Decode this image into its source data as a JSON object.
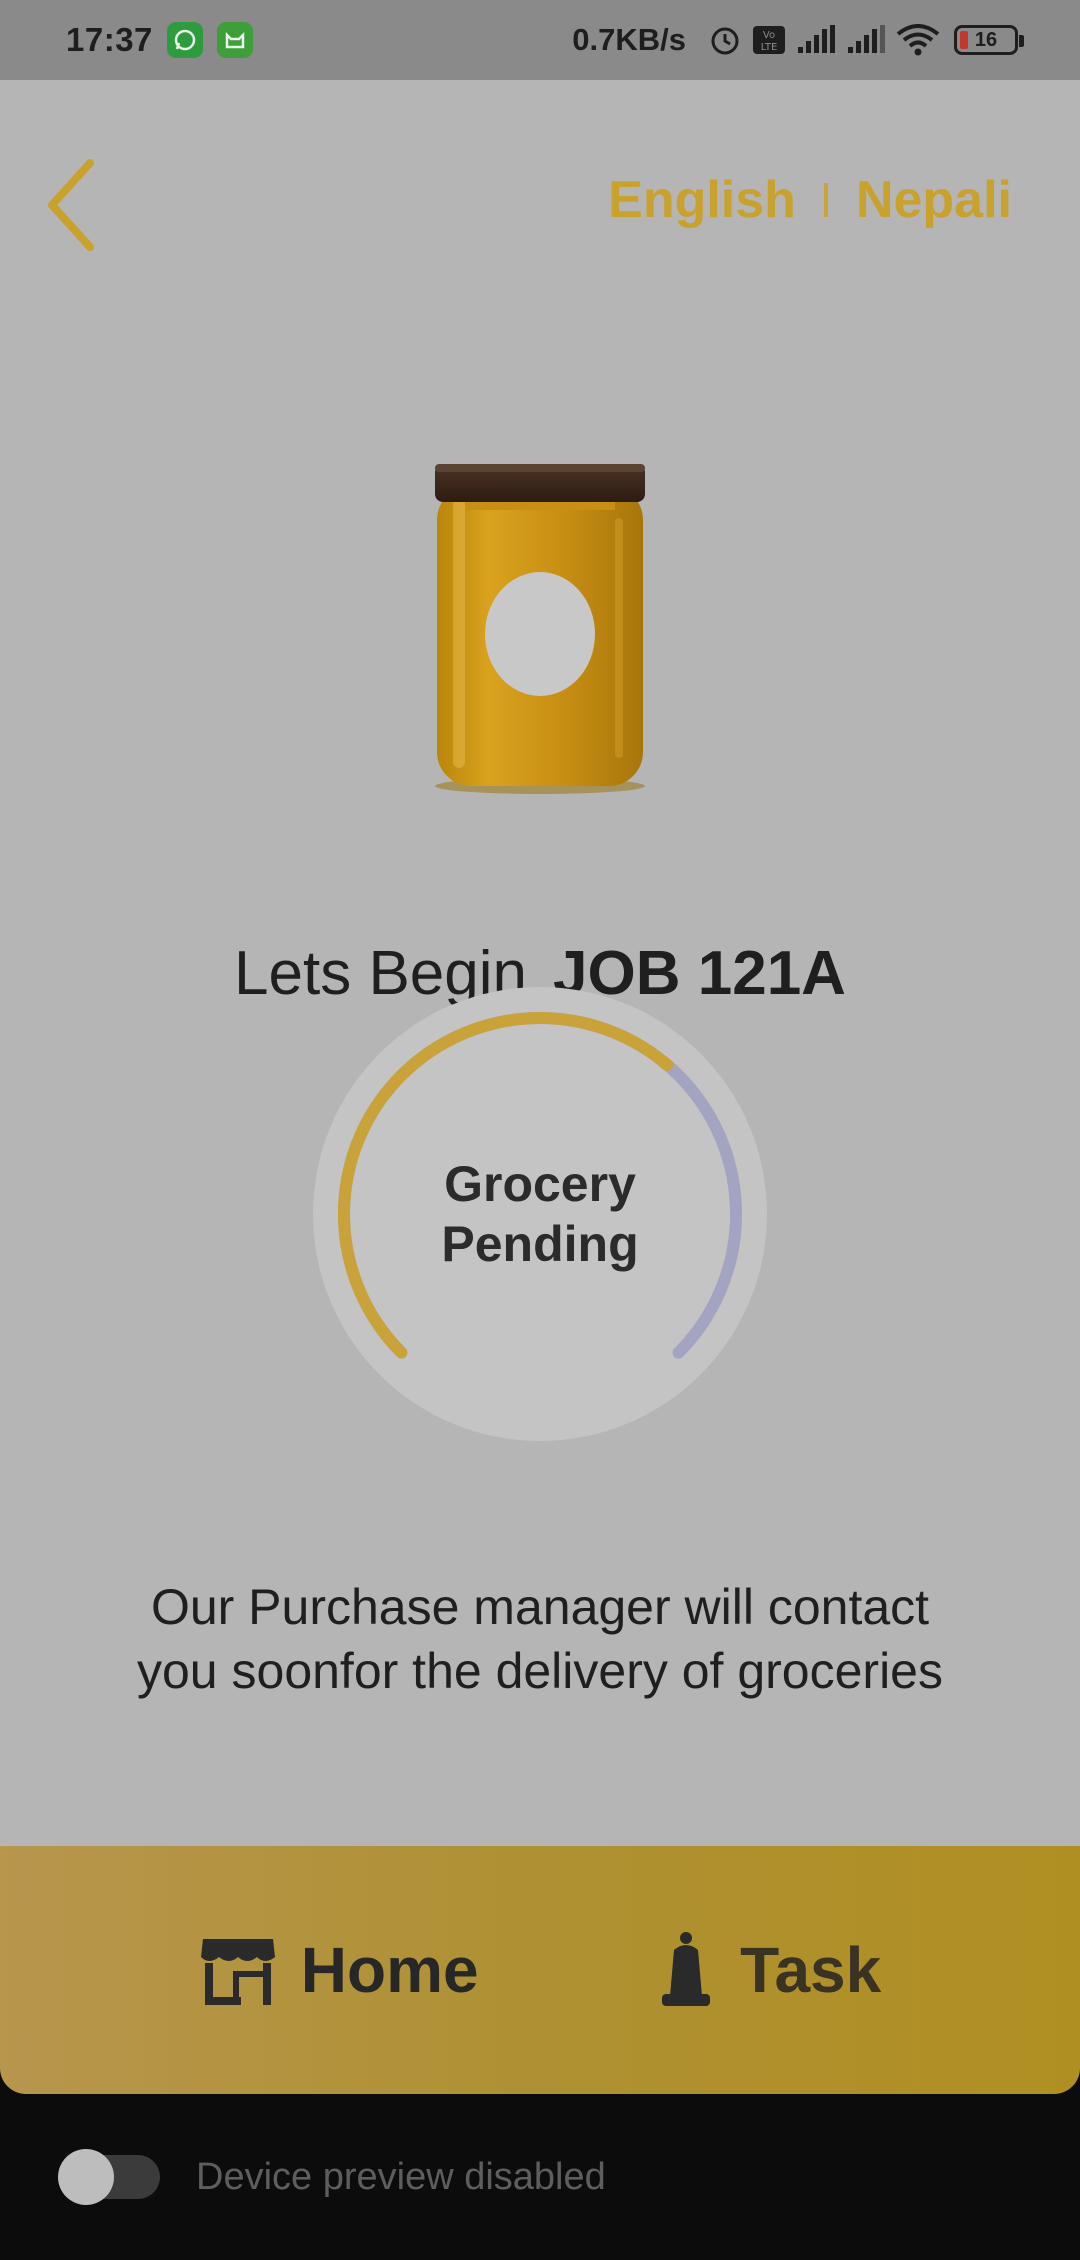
{
  "status_bar": {
    "time": "17:37",
    "speed": "0.7KB/s",
    "battery": "16",
    "icons": [
      "whatsapp-icon",
      "cat-app-icon",
      "alarm-icon",
      "volte-icon",
      "signal-icon",
      "signal-icon-2",
      "wifi-icon",
      "battery-icon"
    ]
  },
  "header": {
    "back_icon": "chevron-left-icon",
    "languages": [
      "English",
      "Nepali"
    ]
  },
  "hero": {
    "image": "honey-jar"
  },
  "title": {
    "lead": "Lets Begin",
    "job": "JOB 121A"
  },
  "progress": {
    "line1": "Grocery",
    "line2": "Pending",
    "completed_fraction": 0.65,
    "colors": {
      "done": "#c9a23a",
      "remaining": "#a3a3c2",
      "ring_bg": "#c4c4c4"
    }
  },
  "message": {
    "line1": "Our Purchase manager will contact",
    "line2": "you soonfor the delivery of groceries"
  },
  "bottom_nav": {
    "items": [
      {
        "label": "Home",
        "icon": "store-icon"
      },
      {
        "label": "Task",
        "icon": "bell-icon"
      }
    ]
  },
  "preview": {
    "label": "Device preview disabled",
    "enabled": false
  },
  "colors": {
    "accent": "#c9a12d",
    "screen_bg": "#b5b5b5",
    "nav_bg": "#b08f22"
  }
}
